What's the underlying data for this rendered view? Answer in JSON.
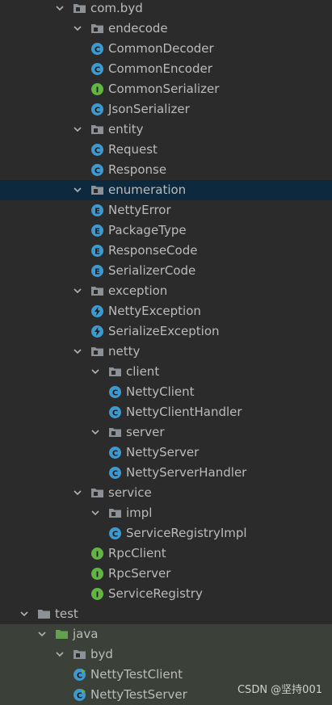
{
  "tree": {
    "rows": [
      {
        "label": "com.byd",
        "icon": "package-folder-icon",
        "expanded": true
      },
      {
        "label": "endecode",
        "icon": "package-folder-icon",
        "expanded": true
      },
      {
        "label": "CommonDecoder",
        "icon": "class-icon"
      },
      {
        "label": "CommonEncoder",
        "icon": "class-icon"
      },
      {
        "label": "CommonSerializer",
        "icon": "interface-icon"
      },
      {
        "label": "JsonSerializer",
        "icon": "class-icon"
      },
      {
        "label": "entity",
        "icon": "package-folder-icon",
        "expanded": true
      },
      {
        "label": "Request",
        "icon": "class-icon"
      },
      {
        "label": "Response",
        "icon": "class-icon"
      },
      {
        "label": "enumeration",
        "icon": "package-folder-icon",
        "expanded": true,
        "selected": true
      },
      {
        "label": "NettyError",
        "icon": "enum-icon"
      },
      {
        "label": "PackageType",
        "icon": "enum-icon"
      },
      {
        "label": "ResponseCode",
        "icon": "enum-icon"
      },
      {
        "label": "SerializerCode",
        "icon": "enum-icon"
      },
      {
        "label": "exception",
        "icon": "package-folder-icon",
        "expanded": true
      },
      {
        "label": "NettyException",
        "icon": "exception-icon"
      },
      {
        "label": "SerializeException",
        "icon": "exception-icon"
      },
      {
        "label": "netty",
        "icon": "package-folder-icon",
        "expanded": true
      },
      {
        "label": "client",
        "icon": "package-folder-icon",
        "expanded": true
      },
      {
        "label": "NettyClient",
        "icon": "class-icon"
      },
      {
        "label": "NettyClientHandler",
        "icon": "class-icon"
      },
      {
        "label": "server",
        "icon": "package-folder-icon",
        "expanded": true
      },
      {
        "label": "NettyServer",
        "icon": "class-icon"
      },
      {
        "label": "NettyServerHandler",
        "icon": "class-icon"
      },
      {
        "label": "service",
        "icon": "package-folder-icon",
        "expanded": true
      },
      {
        "label": "impl",
        "icon": "package-folder-icon",
        "expanded": true
      },
      {
        "label": "ServiceRegistryImpl",
        "icon": "class-icon"
      },
      {
        "label": "RpcClient",
        "icon": "interface-icon"
      },
      {
        "label": "RpcServer",
        "icon": "interface-icon"
      },
      {
        "label": "ServiceRegistry",
        "icon": "interface-icon"
      },
      {
        "label": "test",
        "icon": "folder-icon",
        "expanded": true
      },
      {
        "label": "java",
        "icon": "test-source-folder-icon",
        "expanded": true,
        "test": true
      },
      {
        "label": "byd",
        "icon": "package-folder-icon",
        "expanded": true,
        "test": true
      },
      {
        "label": "NettyTestClient",
        "icon": "runnable-class-icon",
        "test": true
      },
      {
        "label": "NettyTestServer",
        "icon": "runnable-class-icon",
        "test": true
      }
    ]
  },
  "watermark": "CSDN @坚持001",
  "colors": {
    "background": "#2b2b2b",
    "selection": "#0d293e",
    "test_area": "#3b4139",
    "class_icon": "#3d9ad1",
    "interface_icon": "#62b543",
    "folder": "#8b9197",
    "test_folder": "#62a24e"
  }
}
